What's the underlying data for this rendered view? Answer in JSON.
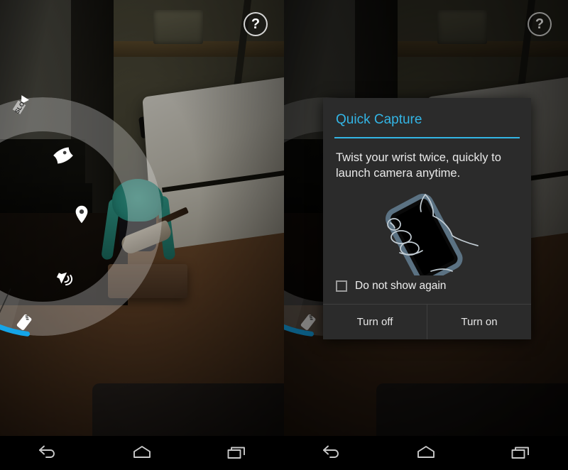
{
  "panels": [
    {
      "id": "left",
      "name": "camera-settings-arc-menu-screen",
      "help_button": {
        "label": "?",
        "icon": "help-question-icon"
      },
      "arc_menu": {
        "selected_index": 4,
        "accent_color": "#15a5e8",
        "items": [
          {
            "label": "SLO",
            "icon": "slow-motion-video-icon"
          },
          {
            "label": "Photo Sphere",
            "icon": "photo-sphere-icon"
          },
          {
            "label": "Location",
            "icon": "location-pin-icon"
          },
          {
            "label": "Shutter sound",
            "icon": "speaker-sound-on-icon"
          },
          {
            "label": "Quick Capture",
            "icon": "twist-wrist-phone-icon"
          }
        ]
      },
      "dialog": null
    },
    {
      "id": "right",
      "name": "quick-capture-dialog-screen",
      "help_button": {
        "label": "?",
        "icon": "help-question-icon"
      },
      "arc_menu": {
        "selected_index": 4,
        "accent_color": "#15a5e8",
        "items": [
          {
            "label": "SLO",
            "icon": "slow-motion-video-icon"
          },
          {
            "label": "Photo Sphere",
            "icon": "photo-sphere-icon"
          },
          {
            "label": "Location",
            "icon": "location-pin-icon"
          },
          {
            "label": "Shutter sound",
            "icon": "speaker-sound-on-icon"
          },
          {
            "label": "Quick Capture",
            "icon": "twist-wrist-phone-icon"
          }
        ]
      },
      "dialog": {
        "title": "Quick Capture",
        "title_color": "#33b5e5",
        "body": "Twist your wrist twice, quickly to launch camera anytime.",
        "illustration_icon": "hand-holding-phone-twist-icon",
        "checkbox": {
          "label": "Do not show again",
          "checked": false
        },
        "buttons": [
          {
            "label": "Turn off",
            "name": "turn-off-button"
          },
          {
            "label": "Turn on",
            "name": "turn-on-button"
          }
        ]
      }
    }
  ],
  "navbar": {
    "buttons": [
      {
        "label": "Back",
        "icon": "back-arrow-icon"
      },
      {
        "label": "Home",
        "icon": "home-icon"
      },
      {
        "label": "Recents",
        "icon": "recents-overview-icon"
      }
    ]
  }
}
